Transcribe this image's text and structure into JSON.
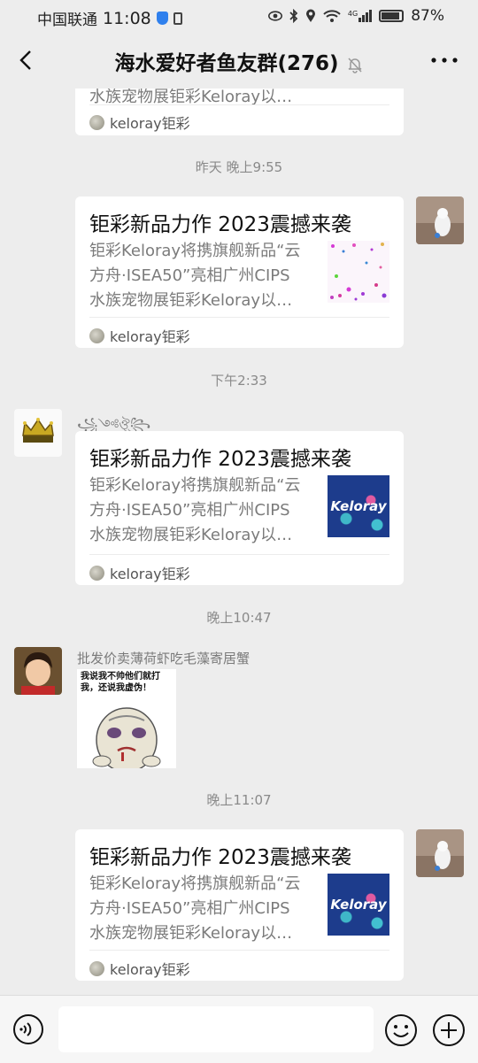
{
  "status_bar": {
    "carrier": "中国联通",
    "time": "11:08",
    "battery": "87%",
    "network_label": "4G"
  },
  "header": {
    "title": "海水爱好者鱼友群(276)"
  },
  "messages": {
    "card_top_partial": {
      "desc_partial": "水族宠物展钜彩Keloray以…",
      "source": "keloray钜彩"
    },
    "ts1": "昨天 晚上9:55",
    "card1": {
      "title": "钜彩新品力作 2023震撼来袭",
      "desc_lines": [
        "钜彩Keloray将携旗舰新品“云",
        "方舟·ISEA50”亮相广州CIPS",
        "水族宠物展钜彩Keloray以…"
      ],
      "source": "keloray钜彩"
    },
    "ts2": "下午2:33",
    "card2": {
      "sender": "꧁༺ঔৣ꧂",
      "title": "钜彩新品力作 2023震撼来袭",
      "desc_lines": [
        "钜彩Keloray将携旗舰新品“云",
        "方舟·ISEA50”亮相广州CIPS",
        "水族宠物展钜彩Keloray以…"
      ],
      "thumb_text": "Keloray",
      "source": "keloray钜彩"
    },
    "ts3": "晚上10:47",
    "sticker_msg": {
      "sender": "批发价卖薄荷虾吃毛藻寄居蟹",
      "sticker_text_line1": "我说我不帅他们就打",
      "sticker_text_line2": "我，还说我虚伪！"
    },
    "ts4": "晚上11:07",
    "card3": {
      "title": "钜彩新品力作 2023震撼来袭",
      "desc_lines": [
        "钜彩Keloray将携旗舰新品“云",
        "方舟·ISEA50”亮相广州CIPS",
        "水族宠物展钜彩Keloray以…"
      ],
      "thumb_text": "Keloray",
      "source": "keloray钜彩"
    }
  },
  "input": {
    "placeholder": ""
  },
  "colors": {
    "background": "#ededed",
    "card": "#ffffff",
    "timestamp": "#8a8a8a",
    "thumb_blue": "#1d3c8c"
  }
}
